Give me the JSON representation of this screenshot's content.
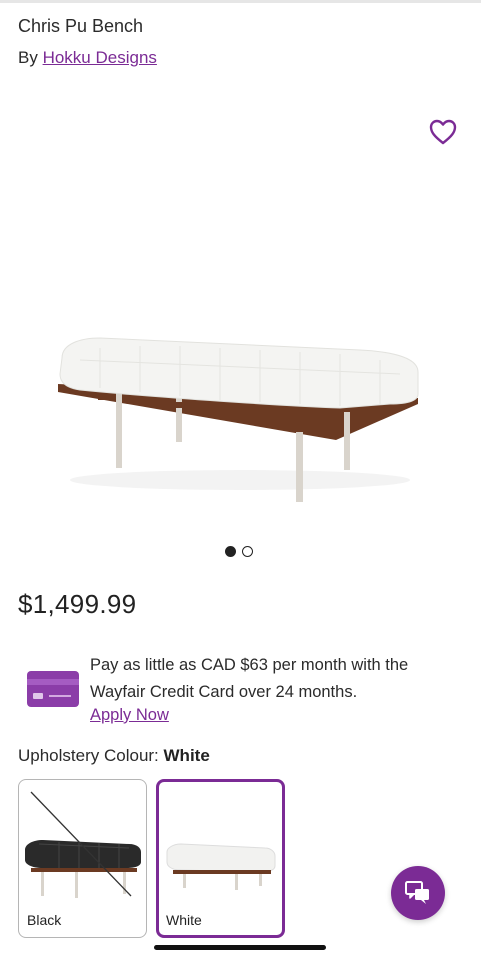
{
  "product": {
    "title": "Chris Pu Bench",
    "by_prefix": "By",
    "brand": "Hokku Designs",
    "price": "$1,499.99"
  },
  "carousel": {
    "total": 2,
    "active": 1
  },
  "financing": {
    "text": "Pay as little as CAD $63 per month with the Wayfair Credit Card over 24 months.",
    "apply_label": "Apply Now"
  },
  "upholstery": {
    "label": "Upholstery Colour:",
    "selected": "White",
    "options": [
      {
        "label": "Black",
        "available": false,
        "selected": false
      },
      {
        "label": "White",
        "available": true,
        "selected": true
      }
    ]
  },
  "icons": {
    "favorite": "heart-icon",
    "chat": "chat-icon",
    "card": "credit-card-icon"
  },
  "colors": {
    "accent": "#7b2b95",
    "text": "#2b2b2b"
  }
}
